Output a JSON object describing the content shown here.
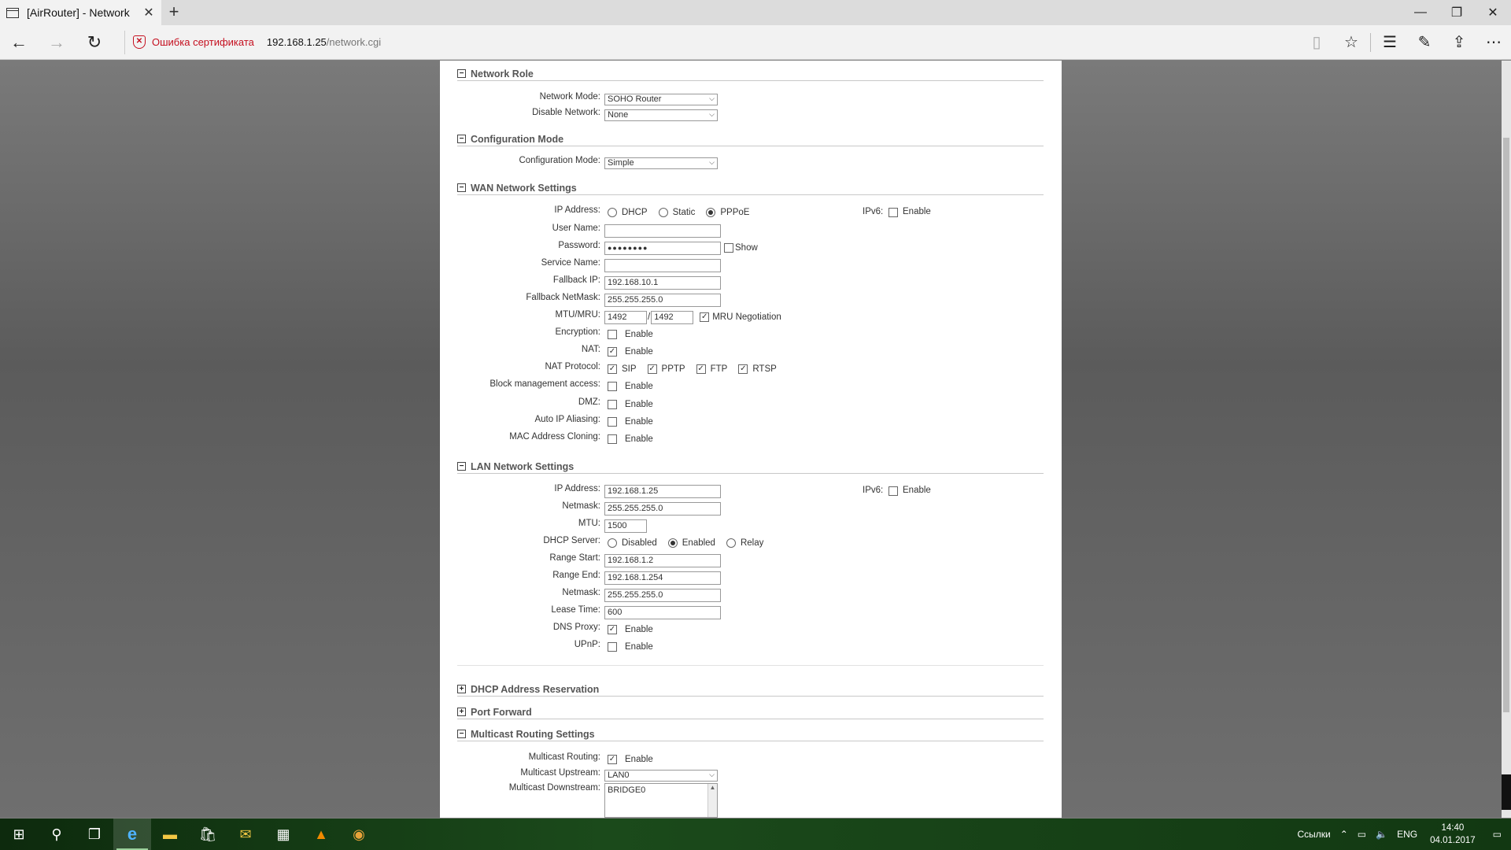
{
  "browser": {
    "tab_title": "[AirRouter] - Network",
    "cert_error": "Ошибка сертификата",
    "url_host": "192.168.1.25",
    "url_path": "/network.cgi"
  },
  "network_role": {
    "title": "Network Role",
    "network_mode_label": "Network Mode:",
    "network_mode_value": "SOHO Router",
    "disable_network_label": "Disable Network:",
    "disable_network_value": "None"
  },
  "config_mode": {
    "title": "Configuration Mode",
    "label": "Configuration Mode:",
    "value": "Simple"
  },
  "wan": {
    "title": "WAN Network Settings",
    "ip_address_label": "IP Address:",
    "ip_options": [
      "DHCP",
      "Static",
      "PPPoE"
    ],
    "ip_selected": "PPPoE",
    "ipv6_label": "IPv6:",
    "enable": "Enable",
    "user_name_label": "User Name:",
    "user_name_value": "",
    "password_label": "Password:",
    "password_value": "●●●●●●●●",
    "show_label": "Show",
    "service_name_label": "Service Name:",
    "service_name_value": "",
    "fallback_ip_label": "Fallback IP:",
    "fallback_ip_value": "192.168.10.1",
    "fallback_netmask_label": "Fallback NetMask:",
    "fallback_netmask_value": "255.255.255.0",
    "mtu_mru_label": "MTU/MRU:",
    "mtu_value": "1492",
    "slash": "/",
    "mru_value": "1492",
    "mru_negotiation_label": "MRU Negotiation",
    "encryption_label": "Encryption:",
    "nat_label": "NAT:",
    "nat_protocol_label": "NAT Protocol:",
    "nat_protocols": [
      "SIP",
      "PPTP",
      "FTP",
      "RTSP"
    ],
    "block_mgmt_label": "Block management access:",
    "dmz_label": "DMZ:",
    "auto_ip_label": "Auto IP Aliasing:",
    "mac_clone_label": "MAC Address Cloning:"
  },
  "lan": {
    "title": "LAN Network Settings",
    "ip_address_label": "IP Address:",
    "ip_address_value": "192.168.1.25",
    "ipv6_label": "IPv6:",
    "enable": "Enable",
    "netmask_label": "Netmask:",
    "netmask_value": "255.255.255.0",
    "mtu_label": "MTU:",
    "mtu_value": "1500",
    "dhcp_server_label": "DHCP Server:",
    "dhcp_options": [
      "Disabled",
      "Enabled",
      "Relay"
    ],
    "dhcp_selected": "Enabled",
    "range_start_label": "Range Start:",
    "range_start_value": "192.168.1.2",
    "range_end_label": "Range End:",
    "range_end_value": "192.168.1.254",
    "netmask2_label": "Netmask:",
    "netmask2_value": "255.255.255.0",
    "lease_time_label": "Lease Time:",
    "lease_time_value": "600",
    "dns_proxy_label": "DNS Proxy:",
    "upnp_label": "UPnP:"
  },
  "dhcp_reservation": {
    "title": "DHCP Address Reservation"
  },
  "port_forward": {
    "title": "Port Forward"
  },
  "multicast": {
    "title": "Multicast Routing Settings",
    "routing_label": "Multicast Routing:",
    "enable": "Enable",
    "upstream_label": "Multicast Upstream:",
    "upstream_value": "LAN0",
    "downstream_label": "Multicast Downstream:",
    "downstream_value": "BRIDGE0"
  },
  "taskbar": {
    "links_label": "Ссылки",
    "lang": "ENG",
    "time": "14:40",
    "date": "04.01.2017"
  }
}
